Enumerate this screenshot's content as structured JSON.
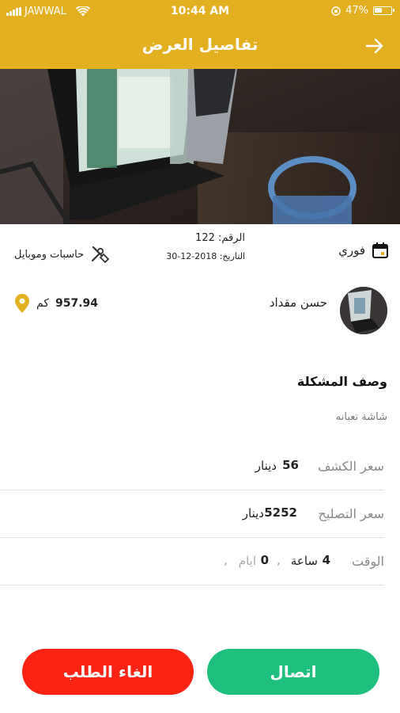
{
  "status_bar": {
    "carrier": "JAWWAL",
    "time": "10:44 AM",
    "battery": "47%",
    "battery_level": 0.47
  },
  "nav": {
    "title": "تفاصيل العرض",
    "back_icon": "arrow-right-icon"
  },
  "hero": {
    "icon": "laptop-photo"
  },
  "info": {
    "urgency": "فوري",
    "urgency_icon": "calendar-icon",
    "number_line": "الرقم: 122",
    "date_line": "التاريخ: 2018-12-30",
    "category": "حاسبات وموبايل",
    "category_icon": "repair-tools-icon"
  },
  "person": {
    "name": "حسن مقداد",
    "distance_value": "957.94",
    "distance_unit": "كم",
    "distance_icon": "location-pin-icon"
  },
  "problem": {
    "title": "وصف المشكلة",
    "description": "شاشة تعبانه"
  },
  "prices": {
    "inspection_label": "سعر الكشف",
    "inspection_value": "56",
    "inspection_unit": "دينار",
    "repair_label": "سعر التصليح",
    "repair_value": "5252",
    "repair_unit": "دينار",
    "time_label": "الوقت",
    "hours_value": "4",
    "hours_unit": "ساعة",
    "days_value": "0",
    "days_unit": "ايام",
    "separator": ","
  },
  "actions": {
    "call_label": "اتصال",
    "cancel_label": "الغاء الطلب"
  },
  "colors": {
    "accent": "#e3b022",
    "call": "#1fbf7d",
    "cancel": "#fb2414"
  }
}
